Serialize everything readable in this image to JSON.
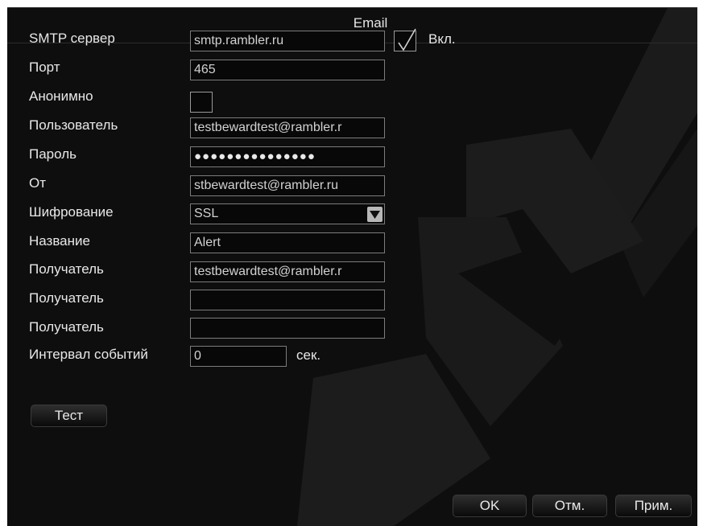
{
  "window": {
    "title": "Email"
  },
  "form": {
    "smtp_server": {
      "label": "SMTP сервер",
      "value": "smtp.rambler.ru",
      "enable_label": "Вкл.",
      "enabled": true
    },
    "port": {
      "label": "Порт",
      "value": "465"
    },
    "anonymous": {
      "label": "Анонимно",
      "checked": false
    },
    "user": {
      "label": "Пользователь",
      "value": "testbewardtest@rambler.r"
    },
    "password": {
      "label": "Пароль",
      "value": "●●●●●●●●●●●●●●●"
    },
    "from": {
      "label": "От",
      "value": "stbewardtest@rambler.ru"
    },
    "encryption": {
      "label": "Шифрование",
      "value": "SSL"
    },
    "subject": {
      "label": "Название",
      "value": "Alert"
    },
    "recipient1": {
      "label": "Получатель",
      "value": "testbewardtest@rambler.r"
    },
    "recipient2": {
      "label": "Получатель",
      "value": ""
    },
    "recipient3": {
      "label": "Получатель",
      "value": ""
    },
    "interval": {
      "label": "Интервал событий",
      "value": "0",
      "unit": "сек."
    }
  },
  "buttons": {
    "test": "Тест",
    "ok": "OK",
    "cancel": "Отм.",
    "apply": "Прим."
  },
  "colors": {
    "background": "#0e0e0e",
    "text": "#e8e8e8",
    "field_border": "#7c7c7c",
    "watermark": "#1e1e1e"
  }
}
